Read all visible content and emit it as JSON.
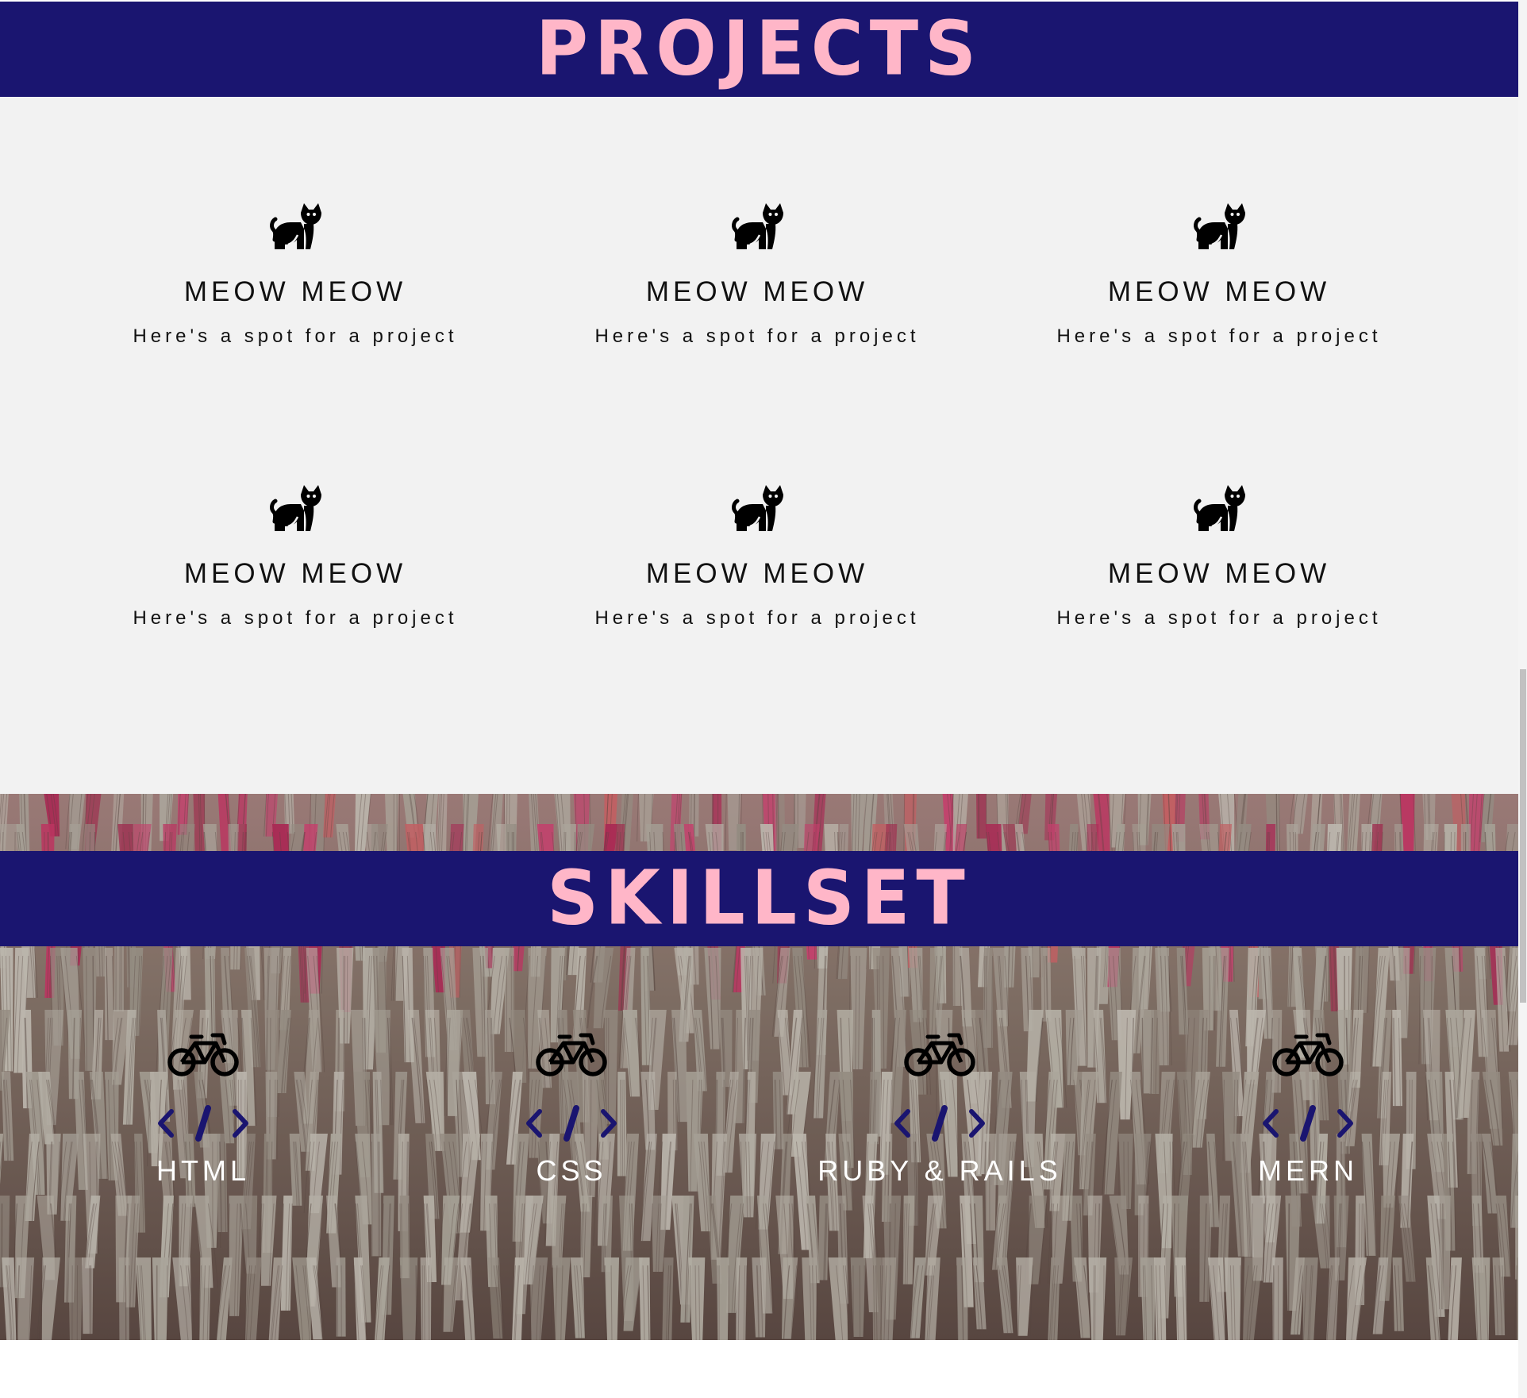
{
  "colors": {
    "banner_bg": "#1a1570",
    "banner_text": "#ffb6c8",
    "projects_bg": "#f2f2f2",
    "project_text": "#111111",
    "skill_text": "#ffffff",
    "code_icon": "#1a1570"
  },
  "projects": {
    "title": "PROJECTS",
    "items": [
      {
        "icon": "cat-icon",
        "title": "MEOW MEOW",
        "description": "Here's a spot for a project"
      },
      {
        "icon": "cat-icon",
        "title": "MEOW MEOW",
        "description": "Here's a spot for a project"
      },
      {
        "icon": "cat-icon",
        "title": "MEOW MEOW",
        "description": "Here's a spot for a project"
      },
      {
        "icon": "cat-icon",
        "title": "MEOW MEOW",
        "description": "Here's a spot for a project"
      },
      {
        "icon": "cat-icon",
        "title": "MEOW MEOW",
        "description": "Here's a spot for a project"
      },
      {
        "icon": "cat-icon",
        "title": "MEOW MEOW",
        "description": "Here's a spot for a project"
      }
    ]
  },
  "skillset": {
    "title": "SKILLSET",
    "items": [
      {
        "icon": "bicycle-icon",
        "secondary_icon": "code-icon",
        "label": "HTML"
      },
      {
        "icon": "bicycle-icon",
        "secondary_icon": "code-icon",
        "label": "CSS"
      },
      {
        "icon": "bicycle-icon",
        "secondary_icon": "code-icon",
        "label": "RUBY & RAILS"
      },
      {
        "icon": "bicycle-icon",
        "secondary_icon": "code-icon",
        "label": "MERN"
      }
    ]
  }
}
